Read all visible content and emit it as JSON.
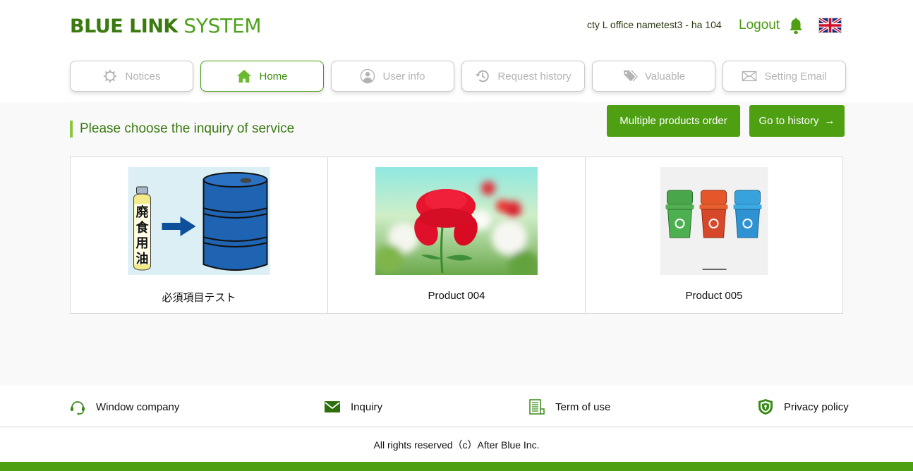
{
  "header": {
    "logo_bold": "BLUE LINK",
    "logo_light": "SYSTEM",
    "user_name": "cty L office nametest3 - ha 104",
    "logout_label": "Logout",
    "notification_icon": "bell-icon",
    "language_icon": "uk-flag-icon"
  },
  "nav": {
    "tabs": [
      {
        "label": "Notices",
        "icon": "gear-icon",
        "active": false
      },
      {
        "label": "Home",
        "icon": "home-icon",
        "active": true
      },
      {
        "label": "User info",
        "icon": "user-icon",
        "active": false
      },
      {
        "label": "Request history",
        "icon": "history-icon",
        "active": false
      },
      {
        "label": "Valuable",
        "icon": "tag-icon",
        "active": false
      },
      {
        "label": "Setting Email",
        "icon": "envelope-icon",
        "active": false
      }
    ]
  },
  "main": {
    "section_title": "Please choose the inquiry of service",
    "multi_order_label": "Multiple products order",
    "history_label": "Go to history",
    "history_arrow": "→",
    "products": [
      {
        "name": "必須項目テスト",
        "image": "waste-oil-to-drum"
      },
      {
        "name": "Product 004",
        "image": "red-rose"
      },
      {
        "name": "Product 005",
        "image": "recycling-bins"
      }
    ],
    "oil_label_chars": [
      "廃",
      "食",
      "用",
      "油"
    ]
  },
  "footer": {
    "links": [
      {
        "label": "Window company",
        "icon": "headset-icon"
      },
      {
        "label": "Inquiry",
        "icon": "mail-icon"
      },
      {
        "label": "Term of use",
        "icon": "document-icon"
      },
      {
        "label": "Privacy policy",
        "icon": "shield-icon"
      }
    ],
    "copyright": "All rights reserved（c）After Blue Inc."
  },
  "colors": {
    "brand_green": "#4e9f12",
    "brand_dark_green": "#3a7a0e",
    "accent_lime": "#8cc63f",
    "inactive_gray": "#b3b3b3"
  }
}
